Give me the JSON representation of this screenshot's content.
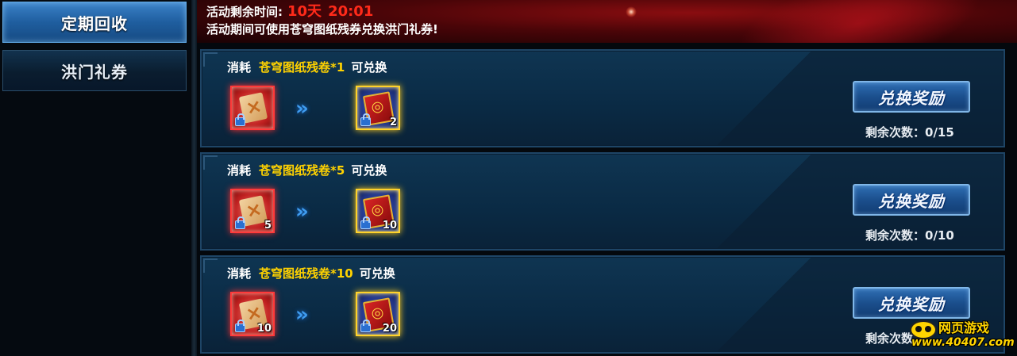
{
  "sidebar": {
    "items": [
      {
        "label": "定期回收",
        "active": true
      },
      {
        "label": "洪门礼券",
        "active": false
      }
    ]
  },
  "header": {
    "remaining_label": "活动剩余时间:",
    "remaining_days": "10天",
    "remaining_clock": "20:01",
    "notice": "活动期间可使用苍穹图纸残券兑换洪门礼券!"
  },
  "exchanges": [
    {
      "prefix": "消耗",
      "cost": "苍穹图纸残卷*1",
      "suffix": "可兑换",
      "input_qty": "",
      "output_qty": "2",
      "button": "兑换奖励",
      "remaining": "剩余次数：0/15"
    },
    {
      "prefix": "消耗",
      "cost": "苍穹图纸残卷*5",
      "suffix": "可兑换",
      "input_qty": "5",
      "output_qty": "10",
      "button": "兑换奖励",
      "remaining": "剩余次数：0/10"
    },
    {
      "prefix": "消耗",
      "cost": "苍穹图纸残卷*10",
      "suffix": "可兑换",
      "input_qty": "10",
      "output_qty": "20",
      "button": "兑换奖励",
      "remaining": "剩余次数"
    }
  ],
  "icons": {
    "input_item": "paper-scroll-icon",
    "output_item": "red-book-icon",
    "lock": "lock-icon",
    "arrow": "double-chevron-right-icon"
  },
  "watermark": {
    "line1": "网页游戏",
    "line2": "www.40407.com"
  },
  "colors": {
    "accent_red": "#ff2a1a",
    "cost_gold": "#ffd200",
    "button_blue": "#1b4f8d"
  }
}
